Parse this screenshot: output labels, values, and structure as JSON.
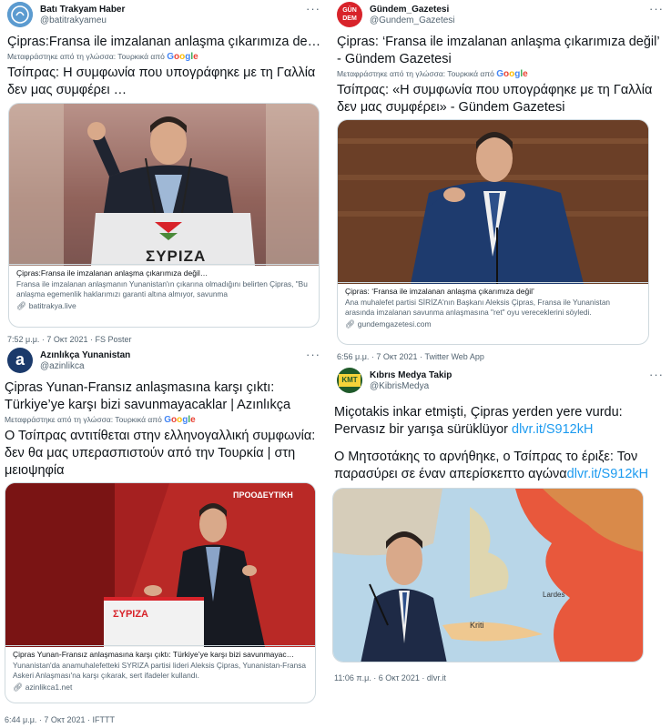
{
  "translate_label": "Μεταφράστηκε από τη γλώσσα: Τουρκικά από",
  "google_word": "Google",
  "tweets": [
    {
      "user_name": "Batı Trakyam Haber",
      "handle": "@batitrakyameu",
      "text_original": "Çipras:Fransa ile imzalanan anlaşma çıkarımıza değil…",
      "text_translated": "Τσίπρας: Η συμφωνία που υπογράφηκε με τη Γαλλία δεν μας συμφέρει …",
      "card": {
        "title": "Çipras:Fransa ile imzalanan anlaşma çıkarımıza değil…",
        "description": "Fransa ile imzalanan anlaşmanın Yunanistan'ın çıkarına olmadığını belirten Çipras, \"Bu anlaşma egemenlik haklarımızı garanti altına almıyor, savunma",
        "domain": "batitrakya.live",
        "podium_text": "ΣΥΡΙΖΑ"
      },
      "meta": "7:52 μ.μ. · 7 Οκτ 2021 · FS Poster"
    },
    {
      "user_name": "Gündem_Gazetesi",
      "handle": "@Gundem_Gazetesi",
      "avatar_text": "GÜN DEM",
      "text_original": "Çipras: ‘Fransa ile imzalanan anlaşma çıkarımıza değil’ - Gündem Gazetesi",
      "text_translated": "Τσίπρας: «Η συμφωνία που υπογράφηκε με τη Γαλλία δεν μας συμφέρει» - Gündem Gazetesi",
      "card": {
        "title": "Çipras: ‘Fransa ile imzalanan anlaşma çıkarımıza değil’",
        "description": "Ana muhalefet partisi SİRİZA'nın Başkanı Aleksis Çipras, Fransa ile Yunanistan arasında imzalanan savunma anlaşmasına \"ret\" oyu vereceklerini söyledi.",
        "domain": "gundemgazetesi.com"
      },
      "meta": "6:56 μ.μ. · 7 Οκτ 2021 · Twitter Web App"
    },
    {
      "user_name": "Azınlıkça Yunanistan",
      "handle": "@azinlikca",
      "text_original": "Çipras Yunan-Fransız anlaşmasına karşı çıktı: Türkiye’ye karşı bizi savunmayacaklar | Azınlıkça",
      "text_translated": "Ο Τσίπρας αντιτίθεται στην ελληνογαλλική συμφωνία: δεν θα μας υπερασπιστούν από την Τουρκία | στη μειοψηφία",
      "card": {
        "title": "Çipras Yunan-Fransız anlaşmasına karşı çıktı: Türkiye’ye karşı bizi savunmayac…",
        "description": "Yunanistan'da anamuhalefetteki SYRIZA partisi lideri Aleksis Çipras, Yunanistan-Fransa Askeri Anlaşması'na karşı çıkarak, sert ifadeler kullandı.",
        "domain": "azinlikca1.net",
        "banner_text": "ΠΡΟΟΔΕΥΤΙΚΗ",
        "podium_text": "ΣΥΡΙΖΑ"
      },
      "meta": "6:44 μ.μ. · 7 Οκτ 2021 · IFTTT"
    },
    {
      "user_name": "Kıbrıs Medya Takip",
      "handle": "@KibrisMedya",
      "avatar_text": "KMT",
      "text_original_main": "Miçotakis inkar etmişti, Çipras yerden yere vurdu: Pervasız bir yarışa sürüklüyor ",
      "text_original_link": "dlvr.it/S912kH",
      "text_translated_main": "Ο Μητσοτάκης το αρνήθηκε, ο Τσίπρας το έριξε: Τον παρασύρει σε έναν απερίσκεπτο αγώνα",
      "text_translated_link": "dlvr.it/S912kH",
      "map_labels": [
        "Lardes",
        "Kriti"
      ],
      "meta": "11:06 π.μ. · 6 Οκτ 2021 · dlvr.it"
    }
  ],
  "colors": {
    "link": "#1d9bf0",
    "secondary_text": "#536471",
    "syriza_red": "#d8232a"
  }
}
